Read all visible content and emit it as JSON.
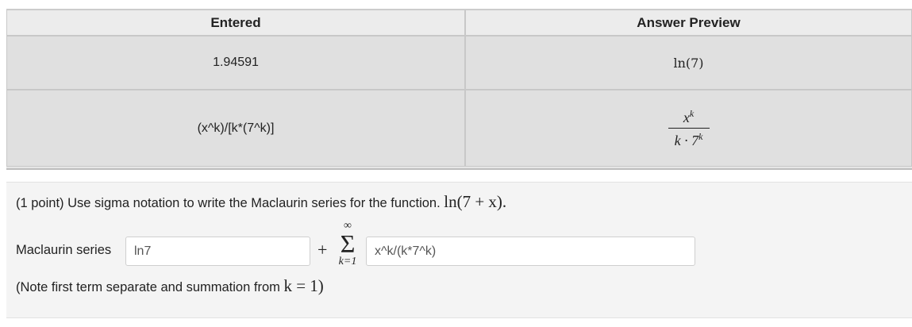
{
  "results_table": {
    "headers": [
      "Entered",
      "Answer Preview"
    ],
    "rows": [
      {
        "entered": "1.94591",
        "preview": "ln(7)"
      },
      {
        "entered": "(x^k)/[k*(7^k)]",
        "preview_num_base": "x",
        "preview_num_exp": "k",
        "preview_den_base": "k · 7",
        "preview_den_exp": "k"
      }
    ]
  },
  "problem": {
    "points": "(1 point)",
    "text": " Use sigma notation to write the Maclaurin series for the function. ",
    "function": "ln(7 + x).",
    "series_label": "Maclaurin series",
    "first_term_value": "ln7",
    "plus": "+",
    "sigma_upper": "∞",
    "sigma_symbol": "Σ",
    "sigma_lower": "k=1",
    "summand_value": "x^k/(k*7^k)",
    "note_prefix": "(Note first term separate and summation from ",
    "note_math": "k = 1",
    "note_suffix": ")"
  }
}
